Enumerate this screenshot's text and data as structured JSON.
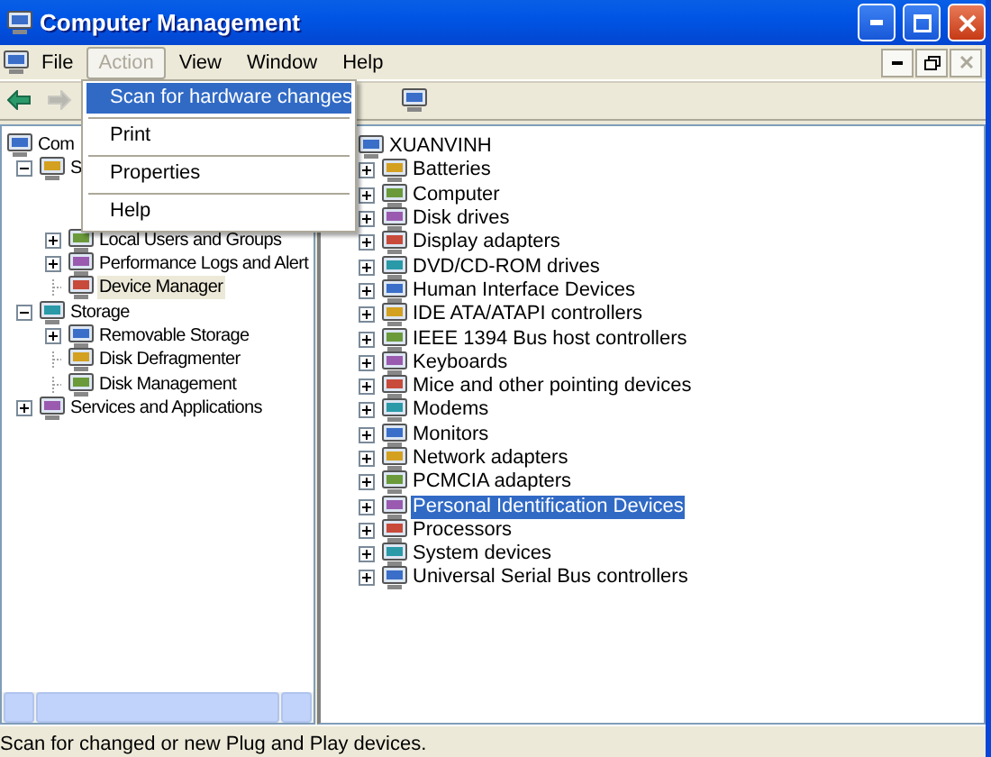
{
  "window": {
    "title": "Computer Management"
  },
  "menu_bar": [
    {
      "label": "File",
      "selected": false
    },
    {
      "label": "Action",
      "selected": true
    },
    {
      "label": "View",
      "selected": false
    },
    {
      "label": "Window",
      "selected": false
    },
    {
      "label": "Help",
      "selected": false
    }
  ],
  "action_menu": [
    {
      "label": "Scan for hardware changes",
      "selected": true
    },
    {
      "label": "Print",
      "selected": false
    },
    {
      "label": "Properties",
      "selected": false
    },
    {
      "label": "Help",
      "selected": false
    }
  ],
  "toolbar": [
    {
      "kind": "back",
      "disabled": false
    },
    {
      "kind": "forward",
      "disabled": true
    }
  ],
  "left_tree": [
    {
      "label": "Com",
      "selected": false,
      "children": [
        {
          "label": "S",
          "expanded": true,
          "selected": false,
          "children": [
            {
              "label": "Local Users and Groups",
              "expanded": false,
              "selected": false
            },
            {
              "label": "Performance Logs and Alert",
              "expanded": false,
              "selected": false
            },
            {
              "label": "Device Manager",
              "selected": true
            }
          ]
        },
        {
          "label": "Storage",
          "expanded": true,
          "selected": false,
          "children": [
            {
              "label": "Removable Storage",
              "expanded": false,
              "selected": false
            },
            {
              "label": "Disk Defragmenter",
              "selected": false
            },
            {
              "label": "Disk Management",
              "selected": false
            }
          ]
        },
        {
          "label": "Services and Applications",
          "expanded": false,
          "selected": false
        }
      ]
    }
  ],
  "device_tree": {
    "root": "XUANVINH",
    "items": [
      {
        "label": "Batteries",
        "selected": false
      },
      {
        "label": "Computer",
        "selected": false
      },
      {
        "label": "Disk drives",
        "selected": false
      },
      {
        "label": "Display adapters",
        "selected": false
      },
      {
        "label": "DVD/CD-ROM drives",
        "selected": false
      },
      {
        "label": "Human Interface Devices",
        "selected": false
      },
      {
        "label": "IDE ATA/ATAPI controllers",
        "selected": false
      },
      {
        "label": "IEEE 1394 Bus host controllers",
        "selected": false
      },
      {
        "label": "Keyboards",
        "selected": false
      },
      {
        "label": "Mice and other pointing devices",
        "selected": false
      },
      {
        "label": "Modems",
        "selected": false
      },
      {
        "label": "Monitors",
        "selected": false
      },
      {
        "label": "Network adapters",
        "selected": false
      },
      {
        "label": "PCMCIA adapters",
        "selected": false
      },
      {
        "label": "Personal Identification Devices",
        "selected": true
      },
      {
        "label": "Processors",
        "selected": false
      },
      {
        "label": "System devices",
        "selected": false
      },
      {
        "label": "Universal Serial Bus controllers",
        "selected": false
      }
    ]
  },
  "status_bar": "Scan for changed or new Plug and Play devices."
}
